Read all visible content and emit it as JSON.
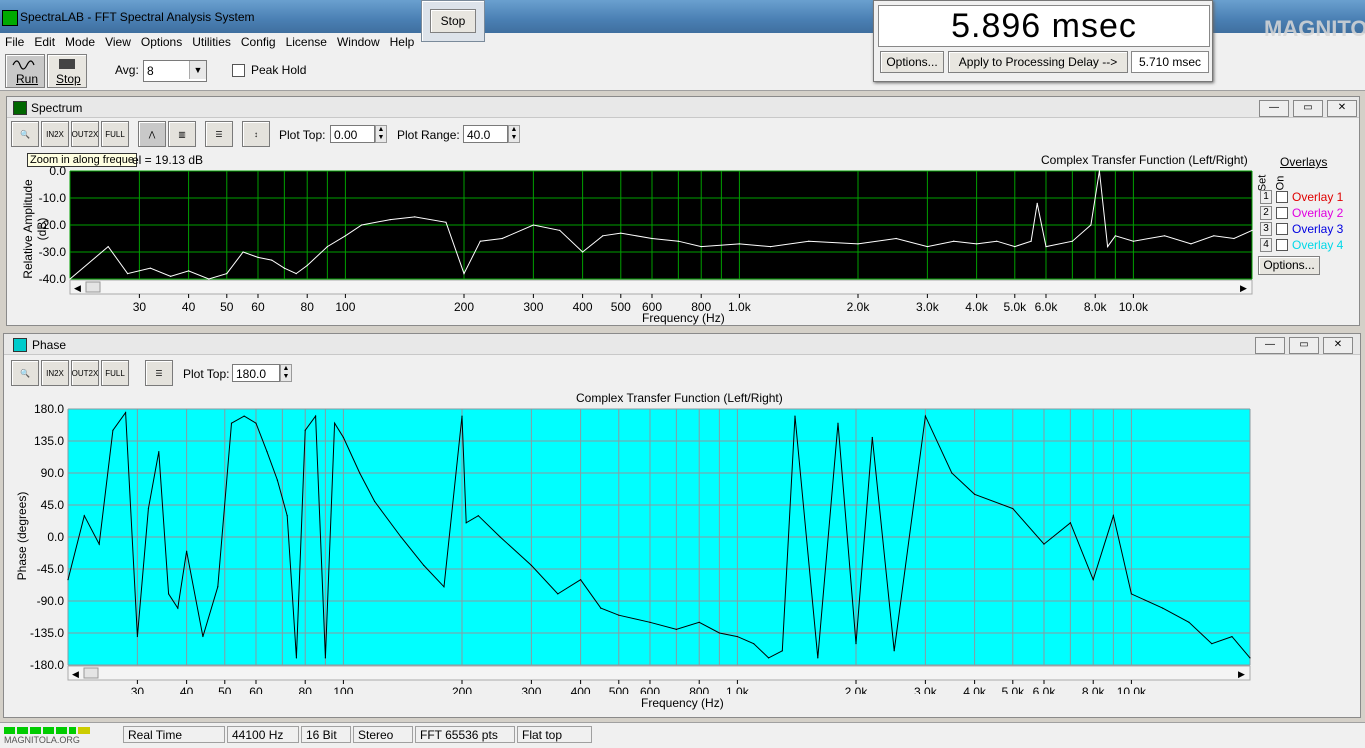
{
  "window": {
    "title": "SpectraLAB - FFT Spectral Analysis System",
    "stop_popup_label": "Stop"
  },
  "menu": [
    "File",
    "Edit",
    "Mode",
    "View",
    "Options",
    "Utilities",
    "Config",
    "License",
    "Window",
    "Help"
  ],
  "toolbar": {
    "run_label": "Run",
    "stop_label": "Stop",
    "avg_label": "Avg:",
    "avg_value": "8",
    "peak_hold_label": "Peak Hold"
  },
  "delay_panel": {
    "readout": "5.896 msec",
    "options_label": "Options...",
    "apply_label": "Apply to Processing Delay -->",
    "delay_value": "5.710 msec"
  },
  "logo_text": "MAGNITOLA",
  "spectrum": {
    "title": "Spectrum",
    "plot_top_label": "Plot Top:",
    "plot_top_value": "0.00",
    "plot_range_label": "Plot Range:",
    "plot_range_value": "40.0",
    "tooltip": "Zoom in along freque",
    "level_text": "el = 19.13 dB",
    "chart_title": "Complex Transfer Function (Left/Right)",
    "ylabel": "Relative Amplitude (dB)",
    "xlabel": "Frequency (Hz)",
    "yticks": [
      "0.0",
      "-10.0",
      "-20.0",
      "-30.0",
      "-40.0"
    ],
    "xticks": [
      "30",
      "40",
      "50",
      "60",
      "80",
      "100",
      "200",
      "300",
      "400",
      "500",
      "600",
      "800",
      "1.0k",
      "2.0k",
      "3.0k",
      "4.0k",
      "5.0k",
      "6.0k",
      "8.0k",
      "10.0k"
    ],
    "overlays_header": "Overlays",
    "set_label": "Set",
    "on_label": "On",
    "overlays": [
      {
        "num": "1",
        "name": "Overlay 1",
        "color": "#e00000"
      },
      {
        "num": "2",
        "name": "Overlay 2",
        "color": "#e000e0"
      },
      {
        "num": "3",
        "name": "Overlay 3",
        "color": "#0000e0"
      },
      {
        "num": "4",
        "name": "Overlay 4",
        "color": "#00d8e8"
      }
    ],
    "options_label": "Options..."
  },
  "phase": {
    "title": "Phase",
    "plot_top_label": "Plot Top:",
    "plot_top_value": "180.0",
    "chart_title": "Complex Transfer Function (Left/Right)",
    "ylabel": "Phase (degrees)",
    "xlabel": "Frequency (Hz)",
    "yticks": [
      "180.0",
      "135.0",
      "90.0",
      "45.0",
      "0.0",
      "-45.0",
      "-90.0",
      "-135.0",
      "-180.0"
    ],
    "xticks": [
      "30",
      "40",
      "50",
      "60",
      "80",
      "100",
      "200",
      "300",
      "400",
      "500",
      "600",
      "800",
      "1.0k",
      "2.0k",
      "3.0k",
      "4.0k",
      "5.0k",
      "6.0k",
      "8.0k",
      "10.0k"
    ]
  },
  "status": {
    "mode": "Real Time",
    "rate": "44100 Hz",
    "bits": "16 Bit",
    "channels": "Stereo",
    "fft": "FFT 65536 pts",
    "window": "Flat top",
    "watermark": "MAGNITOLA.ORG"
  },
  "colors": {
    "spectrum_bg": "#000000",
    "spectrum_grid": "#00a000",
    "spectrum_trace": "#ffffff",
    "phase_bg": "#00ffff",
    "phase_grid": "#8a9aa0",
    "phase_trace": "#000000"
  },
  "chart_data": [
    {
      "type": "line",
      "title": "Complex Transfer Function (Left/Right)",
      "xlabel": "Frequency (Hz)",
      "ylabel": "Relative Amplitude (dB)",
      "xscale": "log",
      "ylim": [
        -40,
        0
      ],
      "grid": true,
      "x": [
        20,
        25,
        28,
        32,
        36,
        40,
        45,
        50,
        55,
        60,
        65,
        70,
        75,
        80,
        90,
        100,
        110,
        130,
        150,
        180,
        200,
        220,
        250,
        300,
        350,
        400,
        450,
        500,
        600,
        700,
        800,
        1000,
        1200,
        1500,
        2000,
        2500,
        3000,
        3500,
        4000,
        4500,
        5000,
        5500,
        5700,
        6000,
        7000,
        7800,
        8200,
        8600,
        9000,
        10000,
        12000,
        14000,
        16000,
        18000,
        20000
      ],
      "values": [
        -40,
        -28,
        -38,
        -36,
        -39,
        -37,
        -40,
        -38,
        -30,
        -32,
        -33,
        -36,
        -38,
        -35,
        -28,
        -24,
        -20,
        -18,
        -17,
        -19,
        -38,
        -26,
        -25,
        -20,
        -22,
        -30,
        -24,
        -23,
        -25,
        -26,
        -28,
        -27,
        -28,
        -26,
        -27,
        -25,
        -28,
        -26,
        -27,
        -26,
        -28,
        -26,
        -12,
        -28,
        -26,
        -20,
        0,
        -28,
        -24,
        -26,
        -24,
        -27,
        -24,
        -25,
        -22
      ]
    },
    {
      "type": "line",
      "title": "Complex Transfer Function (Left/Right)",
      "xlabel": "Frequency (Hz)",
      "ylabel": "Phase (degrees)",
      "xscale": "log",
      "ylim": [
        -180,
        180
      ],
      "grid": true,
      "x": [
        20,
        22,
        24,
        26,
        28,
        30,
        32,
        34,
        36,
        38,
        40,
        44,
        48,
        52,
        56,
        60,
        64,
        68,
        72,
        76,
        80,
        85,
        90,
        95,
        100,
        110,
        120,
        140,
        160,
        180,
        200,
        205,
        220,
        250,
        300,
        350,
        400,
        450,
        500,
        600,
        700,
        800,
        900,
        1000,
        1100,
        1200,
        1300,
        1400,
        1600,
        1800,
        2000,
        2200,
        2500,
        3000,
        3500,
        4000,
        5000,
        6000,
        7000,
        8000,
        9000,
        10000,
        12000,
        14000,
        16000,
        18000,
        20000
      ],
      "values": [
        -60,
        30,
        -10,
        150,
        175,
        -140,
        40,
        120,
        -80,
        -100,
        -20,
        -140,
        -70,
        160,
        170,
        160,
        120,
        80,
        30,
        -170,
        150,
        170,
        -170,
        160,
        140,
        90,
        50,
        0,
        -40,
        -70,
        170,
        20,
        30,
        0,
        -40,
        -80,
        -60,
        -100,
        -110,
        -120,
        -130,
        -120,
        -135,
        -140,
        -150,
        -170,
        -160,
        170,
        -170,
        160,
        -150,
        140,
        -160,
        170,
        90,
        60,
        40,
        -10,
        20,
        -60,
        30,
        -80,
        -100,
        -120,
        -150,
        -140,
        -170
      ]
    }
  ]
}
